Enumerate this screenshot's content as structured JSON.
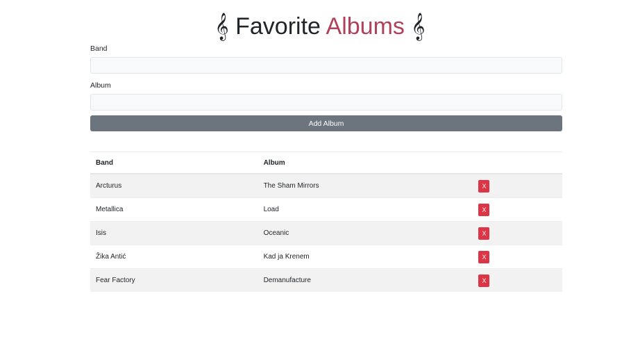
{
  "header": {
    "clef_left": "𝄞",
    "title_main": "Favorite",
    "title_accent": "Albums",
    "clef_right": "𝄞"
  },
  "form": {
    "band_label": "Band",
    "band_value": "",
    "album_label": "Album",
    "album_value": "",
    "add_button_label": "Add Album"
  },
  "table": {
    "headers": {
      "band": "Band",
      "album": "Album"
    },
    "rows": [
      {
        "band": "Arcturus",
        "album": "The Sham Mirrors",
        "delete_label": "X"
      },
      {
        "band": "Metallica",
        "album": "Load",
        "delete_label": "X"
      },
      {
        "band": "Isis",
        "album": "Oceanic",
        "delete_label": "X"
      },
      {
        "band": "Žika Antić",
        "album": "Kad ja Krenem",
        "delete_label": "X"
      },
      {
        "band": "Fear Factory",
        "album": "Demanufacture",
        "delete_label": "X"
      }
    ]
  },
  "colors": {
    "accent": "#b0415a",
    "button_secondary": "#6c757d",
    "button_danger": "#dc3545",
    "striped_row": "#f2f2f2"
  },
  "icons": {
    "clef": "treble-clef-icon"
  }
}
